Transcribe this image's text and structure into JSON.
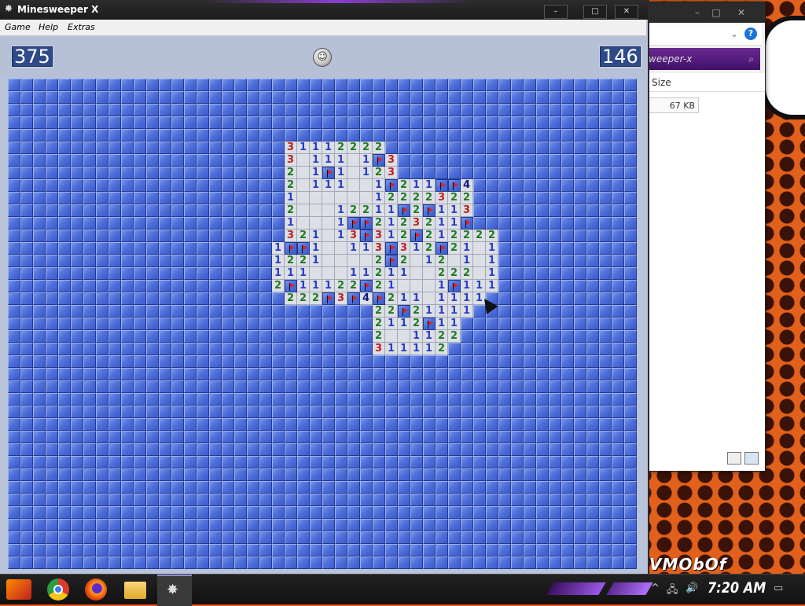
{
  "window": {
    "title": "Minesweeper X",
    "controls": {
      "minimize": "–",
      "maximize": "□",
      "close": "✕"
    }
  },
  "menu": {
    "items": [
      "Game",
      "Help",
      "Extras"
    ]
  },
  "header": {
    "mines_counter": "375",
    "timer": "146",
    "face_icon": "smiley-face-icon"
  },
  "board": {
    "hidden_color": "#4f6fda",
    "open_color": "#dcdfe6",
    "number_colors": {
      "1": "#2a3ec4",
      "2": "#1f7a1f",
      "3": "#c41e1e",
      "4": "#0e1a7a"
    },
    "cells": [
      [
        22,
        5,
        "3"
      ],
      [
        23,
        5,
        "1"
      ],
      [
        24,
        5,
        "1"
      ],
      [
        25,
        5,
        "1"
      ],
      [
        26,
        5,
        "2"
      ],
      [
        27,
        5,
        "2"
      ],
      [
        28,
        5,
        "2"
      ],
      [
        29,
        5,
        "2"
      ],
      [
        22,
        6,
        "3"
      ],
      [
        23,
        6,
        ""
      ],
      [
        24,
        6,
        "1"
      ],
      [
        25,
        6,
        "1"
      ],
      [
        26,
        6,
        "1"
      ],
      [
        27,
        6,
        ""
      ],
      [
        28,
        6,
        "1"
      ],
      [
        29,
        6,
        "F"
      ],
      [
        30,
        6,
        "3"
      ],
      [
        22,
        7,
        "2"
      ],
      [
        23,
        7,
        ""
      ],
      [
        24,
        7,
        "1"
      ],
      [
        25,
        7,
        "F"
      ],
      [
        26,
        7,
        "1"
      ],
      [
        27,
        7,
        ""
      ],
      [
        28,
        7,
        "1"
      ],
      [
        29,
        7,
        "2"
      ],
      [
        30,
        7,
        "3"
      ],
      [
        22,
        8,
        "2"
      ],
      [
        23,
        8,
        ""
      ],
      [
        24,
        8,
        "1"
      ],
      [
        25,
        8,
        "1"
      ],
      [
        26,
        8,
        "1"
      ],
      [
        27,
        8,
        ""
      ],
      [
        28,
        8,
        ""
      ],
      [
        29,
        8,
        "1"
      ],
      [
        30,
        8,
        "F"
      ],
      [
        31,
        8,
        "2"
      ],
      [
        32,
        8,
        "1"
      ],
      [
        33,
        8,
        "1"
      ],
      [
        34,
        8,
        "F"
      ],
      [
        35,
        8,
        "F"
      ],
      [
        36,
        8,
        "4"
      ],
      [
        22,
        9,
        "1"
      ],
      [
        23,
        9,
        ""
      ],
      [
        24,
        9,
        ""
      ],
      [
        25,
        9,
        ""
      ],
      [
        26,
        9,
        ""
      ],
      [
        27,
        9,
        ""
      ],
      [
        28,
        9,
        ""
      ],
      [
        29,
        9,
        "1"
      ],
      [
        30,
        9,
        "2"
      ],
      [
        31,
        9,
        "2"
      ],
      [
        32,
        9,
        "2"
      ],
      [
        33,
        9,
        "2"
      ],
      [
        34,
        9,
        "3"
      ],
      [
        35,
        9,
        "2"
      ],
      [
        36,
        9,
        "2"
      ],
      [
        22,
        10,
        "2"
      ],
      [
        23,
        10,
        ""
      ],
      [
        24,
        10,
        ""
      ],
      [
        25,
        10,
        ""
      ],
      [
        26,
        10,
        "1"
      ],
      [
        27,
        10,
        "2"
      ],
      [
        28,
        10,
        "2"
      ],
      [
        29,
        10,
        "1"
      ],
      [
        30,
        10,
        "1"
      ],
      [
        31,
        10,
        "F"
      ],
      [
        32,
        10,
        "2"
      ],
      [
        33,
        10,
        "F"
      ],
      [
        34,
        10,
        "1"
      ],
      [
        35,
        10,
        "1"
      ],
      [
        36,
        10,
        "3"
      ],
      [
        22,
        11,
        "1"
      ],
      [
        23,
        11,
        ""
      ],
      [
        24,
        11,
        ""
      ],
      [
        25,
        11,
        ""
      ],
      [
        26,
        11,
        "1"
      ],
      [
        27,
        11,
        "F"
      ],
      [
        28,
        11,
        "F"
      ],
      [
        29,
        11,
        "2"
      ],
      [
        30,
        11,
        "1"
      ],
      [
        31,
        11,
        "2"
      ],
      [
        32,
        11,
        "3"
      ],
      [
        33,
        11,
        "2"
      ],
      [
        34,
        11,
        "1"
      ],
      [
        35,
        11,
        "1"
      ],
      [
        36,
        11,
        "F"
      ],
      [
        22,
        12,
        "3"
      ],
      [
        23,
        12,
        "2"
      ],
      [
        24,
        12,
        "1"
      ],
      [
        25,
        12,
        ""
      ],
      [
        26,
        12,
        "1"
      ],
      [
        27,
        12,
        "3"
      ],
      [
        28,
        12,
        "F"
      ],
      [
        29,
        12,
        "3"
      ],
      [
        30,
        12,
        "1"
      ],
      [
        31,
        12,
        "2"
      ],
      [
        32,
        12,
        "F"
      ],
      [
        33,
        12,
        "2"
      ],
      [
        34,
        12,
        "1"
      ],
      [
        35,
        12,
        "2"
      ],
      [
        36,
        12,
        "2"
      ],
      [
        37,
        12,
        "2"
      ],
      [
        38,
        12,
        "2"
      ],
      [
        21,
        13,
        "1"
      ],
      [
        22,
        13,
        "F"
      ],
      [
        23,
        13,
        "F"
      ],
      [
        24,
        13,
        "1"
      ],
      [
        25,
        13,
        ""
      ],
      [
        26,
        13,
        ""
      ],
      [
        27,
        13,
        "1"
      ],
      [
        28,
        13,
        "1"
      ],
      [
        29,
        13,
        "3"
      ],
      [
        30,
        13,
        "F"
      ],
      [
        31,
        13,
        "3"
      ],
      [
        32,
        13,
        "1"
      ],
      [
        33,
        13,
        "2"
      ],
      [
        34,
        13,
        "F"
      ],
      [
        35,
        13,
        "2"
      ],
      [
        36,
        13,
        "1"
      ],
      [
        37,
        13,
        ""
      ],
      [
        38,
        13,
        "1"
      ],
      [
        21,
        14,
        "1"
      ],
      [
        22,
        14,
        "2"
      ],
      [
        23,
        14,
        "2"
      ],
      [
        24,
        14,
        "1"
      ],
      [
        25,
        14,
        ""
      ],
      [
        26,
        14,
        ""
      ],
      [
        27,
        14,
        ""
      ],
      [
        28,
        14,
        ""
      ],
      [
        29,
        14,
        "2"
      ],
      [
        30,
        14,
        "F"
      ],
      [
        31,
        14,
        "2"
      ],
      [
        32,
        14,
        ""
      ],
      [
        33,
        14,
        "1"
      ],
      [
        34,
        14,
        "2"
      ],
      [
        35,
        14,
        ""
      ],
      [
        36,
        14,
        "1"
      ],
      [
        37,
        14,
        ""
      ],
      [
        38,
        14,
        "1"
      ],
      [
        21,
        15,
        "1"
      ],
      [
        22,
        15,
        "1"
      ],
      [
        23,
        15,
        "1"
      ],
      [
        24,
        15,
        ""
      ],
      [
        25,
        15,
        ""
      ],
      [
        26,
        15,
        ""
      ],
      [
        27,
        15,
        "1"
      ],
      [
        28,
        15,
        "1"
      ],
      [
        29,
        15,
        "2"
      ],
      [
        30,
        15,
        "1"
      ],
      [
        31,
        15,
        "1"
      ],
      [
        32,
        15,
        ""
      ],
      [
        33,
        15,
        ""
      ],
      [
        34,
        15,
        "2"
      ],
      [
        35,
        15,
        "2"
      ],
      [
        36,
        15,
        "2"
      ],
      [
        37,
        15,
        ""
      ],
      [
        38,
        15,
        "1"
      ],
      [
        21,
        16,
        "2"
      ],
      [
        22,
        16,
        "F"
      ],
      [
        23,
        16,
        "1"
      ],
      [
        24,
        16,
        "1"
      ],
      [
        25,
        16,
        "1"
      ],
      [
        26,
        16,
        "2"
      ],
      [
        27,
        16,
        "2"
      ],
      [
        28,
        16,
        "F"
      ],
      [
        29,
        16,
        "2"
      ],
      [
        30,
        16,
        "1"
      ],
      [
        31,
        16,
        ""
      ],
      [
        32,
        16,
        ""
      ],
      [
        33,
        16,
        ""
      ],
      [
        34,
        16,
        "1"
      ],
      [
        35,
        16,
        "F"
      ],
      [
        36,
        16,
        "1"
      ],
      [
        37,
        16,
        "1"
      ],
      [
        38,
        16,
        "1"
      ],
      [
        22,
        17,
        "2"
      ],
      [
        23,
        17,
        "2"
      ],
      [
        24,
        17,
        "2"
      ],
      [
        25,
        17,
        "F"
      ],
      [
        26,
        17,
        "3"
      ],
      [
        27,
        17,
        "F"
      ],
      [
        28,
        17,
        "4"
      ],
      [
        29,
        17,
        "F"
      ],
      [
        30,
        17,
        "2"
      ],
      [
        31,
        17,
        "1"
      ],
      [
        32,
        17,
        "1"
      ],
      [
        33,
        17,
        ""
      ],
      [
        34,
        17,
        "1"
      ],
      [
        35,
        17,
        "1"
      ],
      [
        36,
        17,
        "1"
      ],
      [
        37,
        17,
        "1"
      ],
      [
        29,
        18,
        "2"
      ],
      [
        30,
        18,
        "2"
      ],
      [
        31,
        18,
        "F"
      ],
      [
        32,
        18,
        "2"
      ],
      [
        33,
        18,
        "1"
      ],
      [
        34,
        18,
        "1"
      ],
      [
        35,
        18,
        "1"
      ],
      [
        36,
        18,
        "1"
      ],
      [
        29,
        19,
        "2"
      ],
      [
        30,
        19,
        "1"
      ],
      [
        31,
        19,
        "1"
      ],
      [
        32,
        19,
        "2"
      ],
      [
        33,
        19,
        "F"
      ],
      [
        34,
        19,
        "1"
      ],
      [
        35,
        19,
        "1"
      ],
      [
        29,
        20,
        "2"
      ],
      [
        30,
        20,
        ""
      ],
      [
        31,
        20,
        ""
      ],
      [
        32,
        20,
        "1"
      ],
      [
        33,
        20,
        "1"
      ],
      [
        34,
        20,
        "2"
      ],
      [
        35,
        20,
        "2"
      ],
      [
        29,
        21,
        "3"
      ],
      [
        30,
        21,
        "1"
      ],
      [
        31,
        21,
        "1"
      ],
      [
        32,
        21,
        "1"
      ],
      [
        33,
        21,
        "1"
      ],
      [
        34,
        21,
        "2"
      ]
    ]
  },
  "explorer": {
    "search_placeholder": "weeper-x",
    "column_size": "Size",
    "file_size": "67 KB"
  },
  "wallpaper_text": "VMObOf",
  "taskbar": {
    "apps": [
      "chrome-icon",
      "firefox-icon",
      "file-explorer-icon",
      "minesweeper-icon"
    ],
    "clock": "7:20 AM",
    "tray_network": "🖧",
    "tray_volume": "🔊",
    "tray_chevron": "^",
    "tray_notifications": "▭"
  }
}
